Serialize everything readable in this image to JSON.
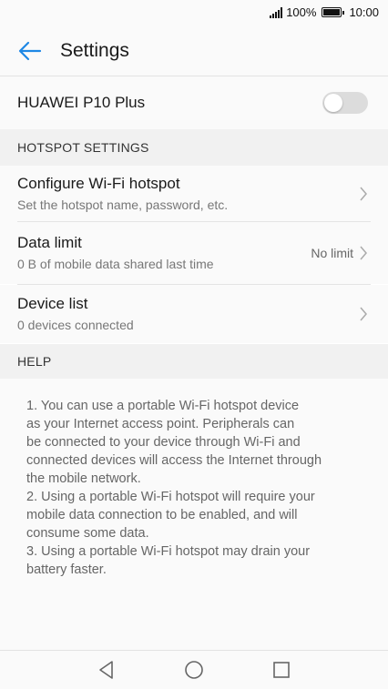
{
  "status": {
    "battery_pct": "100%",
    "time": "10:00"
  },
  "header": {
    "title": "Settings"
  },
  "hotspot": {
    "device_name": "HUAWEI P10 Plus",
    "enabled": false
  },
  "sections": {
    "hotspot_settings": "HOTSPOT SETTINGS",
    "help": "HELP"
  },
  "items": {
    "configure": {
      "title": "Configure Wi-Fi hotspot",
      "subtitle": "Set the hotspot name, password, etc."
    },
    "data_limit": {
      "title": "Data limit",
      "subtitle": "0 B of mobile data shared last time",
      "value": "No limit"
    },
    "device_list": {
      "title": "Device list",
      "subtitle": "0 devices connected"
    }
  },
  "help_lines": [
    "1. You can use a portable Wi-Fi hotspot device",
    "as your Internet access point. Peripherals can",
    "be connected to your device through Wi-Fi and",
    "connected devices will access the Internet through",
    "the mobile network.",
    "2. Using a portable Wi-Fi hotspot will require your",
    "mobile data connection to be enabled, and will",
    "consume some data.",
    "3. Using a portable Wi-Fi hotspot may drain your",
    "battery faster."
  ],
  "colors": {
    "accent": "#1e88e5",
    "toggle_off": "#dcdcdc"
  },
  "icons": {
    "back": "arrow-left-icon",
    "chevron": "chevron-right-icon",
    "nav_back": "triangle-back-icon",
    "nav_home": "circle-home-icon",
    "nav_recent": "square-recent-icon"
  }
}
